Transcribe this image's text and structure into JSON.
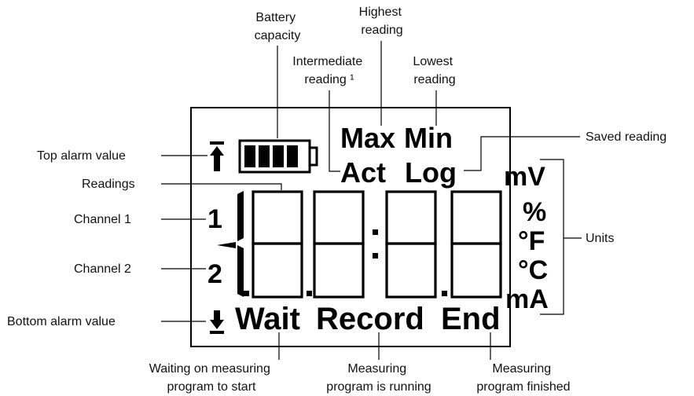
{
  "annotations": {
    "battery_capacity": [
      "Battery",
      "capacity"
    ],
    "highest_reading": [
      "Highest",
      "reading"
    ],
    "intermediate_reading": [
      "Intermediate",
      "reading ¹"
    ],
    "lowest_reading": [
      "Lowest",
      "reading"
    ],
    "saved_reading": "Saved reading",
    "top_alarm_value": "Top alarm value",
    "readings": "Readings",
    "channel_1": "Channel 1",
    "channel_2": "Channel 2",
    "units": "Units",
    "bottom_alarm_value": "Bottom alarm value",
    "waiting": [
      "Waiting on measuring",
      "program to start"
    ],
    "running": [
      "Measuring",
      "program is running"
    ],
    "finished": [
      "Measuring",
      "program finished"
    ]
  },
  "display": {
    "max": "Max",
    "min": "Min",
    "act": "Act",
    "log": "Log",
    "channel_1": "1",
    "channel_2": "2",
    "unit_mv": "mV",
    "unit_percent": "%",
    "unit_f": "°F",
    "unit_c": "°C",
    "unit_ma": "mA",
    "wait": "Wait",
    "record": "Record",
    "end": "End"
  },
  "icons": {
    "top_alarm": "arrow-up-to-bar-icon",
    "bottom_alarm": "arrow-down-to-bar-icon",
    "battery": "battery-icon"
  }
}
